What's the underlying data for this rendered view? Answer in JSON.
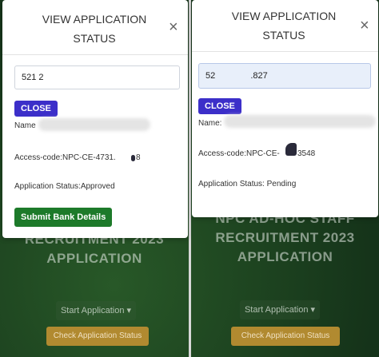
{
  "background": {
    "headline_left": [
      "RECRUITMENT 2023",
      "APPLICATION"
    ],
    "headline_right": [
      "NPC AD-HOC STAFF",
      "RECRUITMENT 2023",
      "APPLICATION"
    ],
    "start_application_label": "Start Application ▾",
    "check_status_label": "Check Application Status"
  },
  "left_modal": {
    "title_line1": "VIEW APPLICATION",
    "title_line2": "STATUS",
    "close_icon": "×",
    "input_value": "521           2",
    "close_button": "CLOSE",
    "name_label": "Name",
    "access_code": "Access-code:NPC-CE-4731.",
    "access_code_tail": "8",
    "application_status": "Application Status:Approved",
    "submit_button": "Submit Bank Details"
  },
  "right_modal": {
    "title_line1": "VIEW APPLICATION",
    "title_line2": "STATUS",
    "close_icon": "×",
    "input_value_prefix": "52",
    "input_value_suffix": ".827",
    "close_button": "CLOSE",
    "name_label": "Name:",
    "access_code": "Access-code:NPC-CE-",
    "access_code_tail": "3548",
    "application_status": "Application Status: Pending"
  },
  "colors": {
    "close_button": "#3c2fc9",
    "submit_button": "#1d7a2a",
    "check_status_button": "#b18a30"
  }
}
